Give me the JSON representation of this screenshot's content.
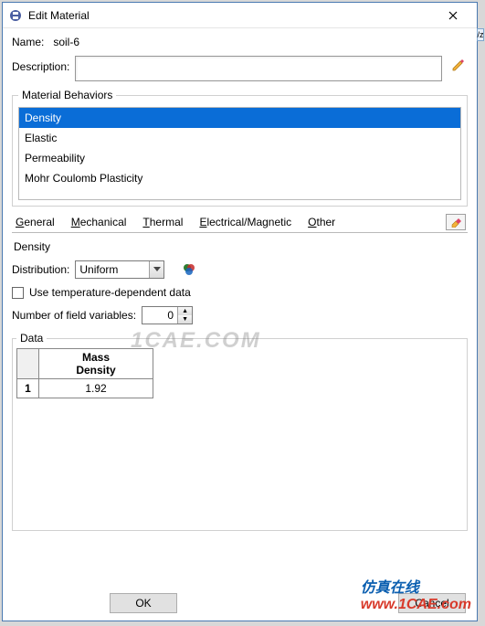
{
  "window": {
    "title": "Edit Material"
  },
  "fields": {
    "name_label": "Name:",
    "name_value": "soil-6",
    "desc_label": "Description:",
    "desc_value": ""
  },
  "behaviors": {
    "legend": "Material Behaviors",
    "items": [
      "Density",
      "Elastic",
      "Permeability",
      "Mohr Coulomb Plasticity"
    ],
    "selected_index": 0
  },
  "tabs": {
    "general": "General",
    "mechanical": "Mechanical",
    "thermal": "Thermal",
    "electrical": "Electrical/Magnetic",
    "other": "Other"
  },
  "density": {
    "section_title": "Density",
    "distribution_label": "Distribution:",
    "distribution_value": "Uniform",
    "temp_checkbox_label": "Use temperature-dependent data",
    "field_vars_label": "Number of field variables:",
    "field_vars_value": "0",
    "data_legend": "Data",
    "col_header_line1": "Mass",
    "col_header_line2": "Density",
    "row1_num": "1",
    "row1_value": "1.92"
  },
  "buttons": {
    "ok": "OK",
    "cancel": "Cancel"
  },
  "watermarks": {
    "center": "1CAE.COM",
    "right_blue": "仿真在线",
    "right_red": "www.1CAE.com"
  }
}
